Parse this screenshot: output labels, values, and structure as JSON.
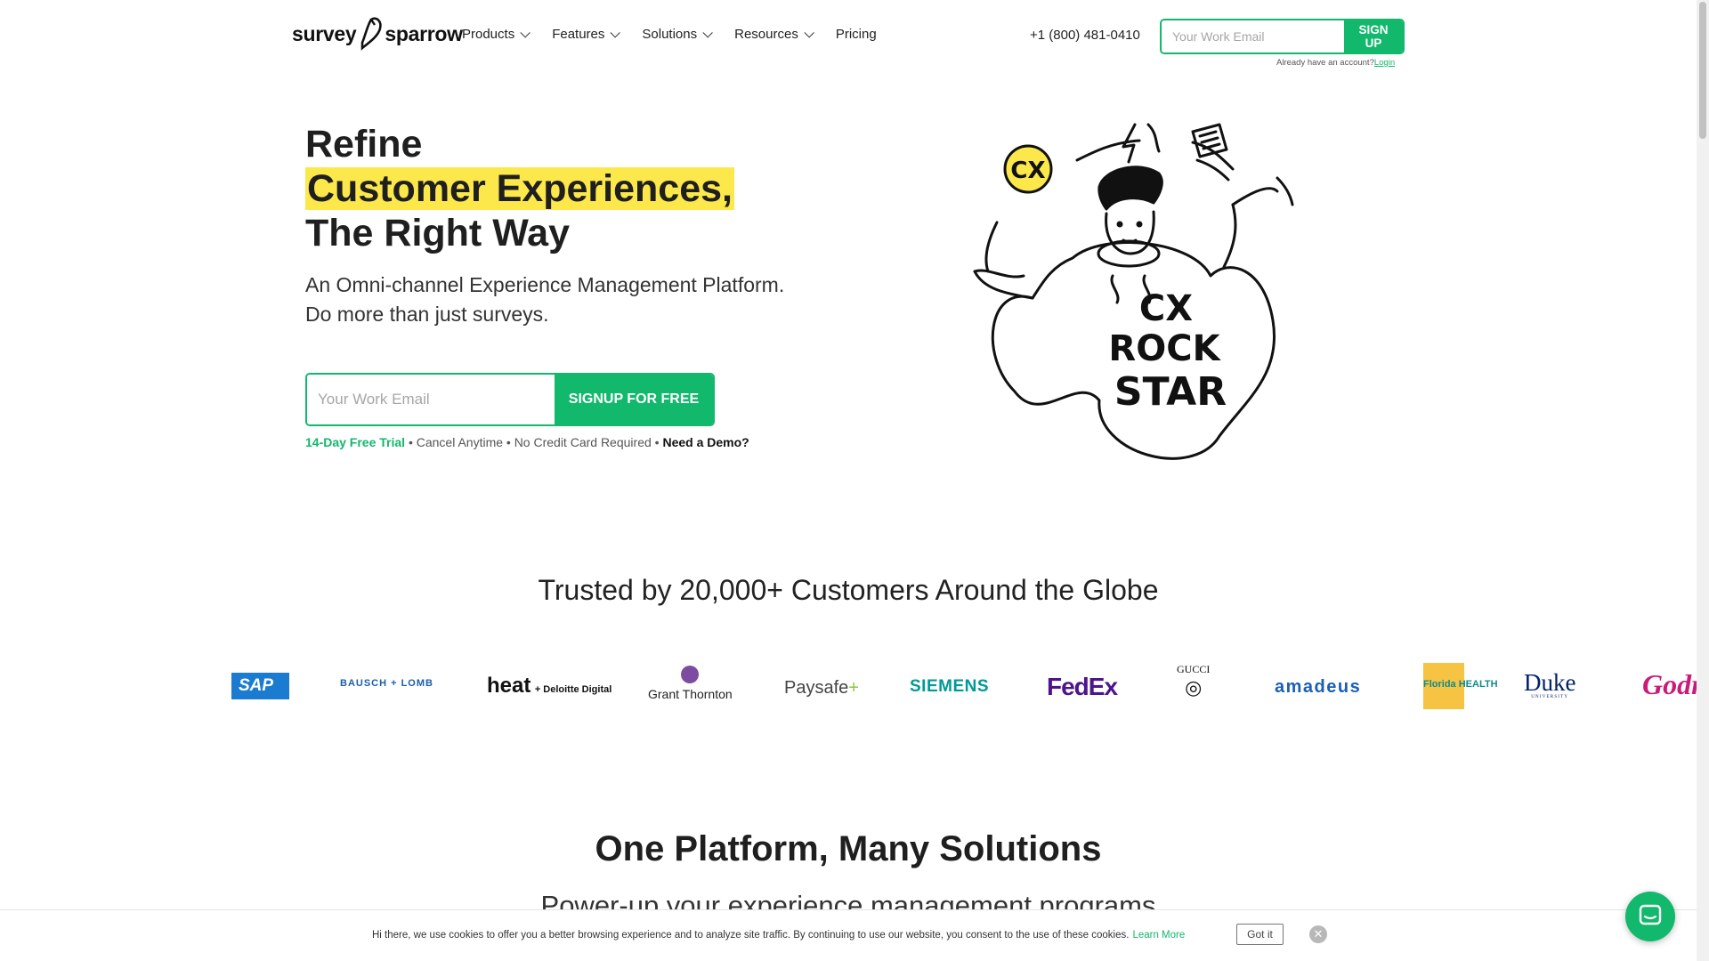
{
  "header": {
    "logo_part1": "survey",
    "logo_part2": "sparrow",
    "nav": [
      {
        "label": "Products",
        "has_dropdown": true
      },
      {
        "label": "Features",
        "has_dropdown": true
      },
      {
        "label": "Solutions",
        "has_dropdown": true
      },
      {
        "label": "Resources",
        "has_dropdown": true
      },
      {
        "label": "Pricing",
        "has_dropdown": false
      }
    ],
    "phone": "+1 (800) 481-0410",
    "email_placeholder": "Your Work Email",
    "signup_label": "SIGN UP",
    "have_account_text": "Already have an account?",
    "login_label": "Login"
  },
  "hero": {
    "title_line1": "Refine",
    "title_line2": "Customer Experiences,",
    "title_line3": "The Right Way",
    "subtitle_line1": "An Omni-channel Experience Management Platform.",
    "subtitle_line2": "Do more than just surveys.",
    "email_placeholder": "Your Work Email",
    "cta_label": "SIGNUP FOR FREE",
    "meta_trial": "14-Day Free Trial",
    "meta_cancel": " • Cancel Anytime • No Credit Card Required • ",
    "meta_demo": "Need a Demo?",
    "illustration_text": [
      "CX",
      "ROCK",
      "STAR"
    ],
    "illustration_badge": "CX"
  },
  "trusted": {
    "title": "Trusted by 20,000+ Customers Around the Globe",
    "logos": [
      "SAP",
      "BAUSCH + LOMB",
      "heat",
      "+ Deloitte Digital",
      "Grant Thornton",
      "Paysafe",
      "SIEMENS",
      "FedEx",
      "GUCCI",
      "amadeus",
      "Florida HEALTH",
      "Duke",
      "UNIVERSITY",
      "Godrej"
    ]
  },
  "platform": {
    "title": "One Platform, Many Solutions",
    "subtitle": "Power-up your experience management programs"
  },
  "cookie": {
    "text": "Hi there, we use cookies to offer you a better browsing experience and to analyze site traffic. By continuing to use our website, you consent to the use of these cookies.",
    "learn_more": "Learn More",
    "got_it": "Got it",
    "close_glyph": "✕"
  },
  "colors": {
    "accent": "#12b86b",
    "highlight": "#fce84a",
    "text": "#1f1f1f"
  }
}
